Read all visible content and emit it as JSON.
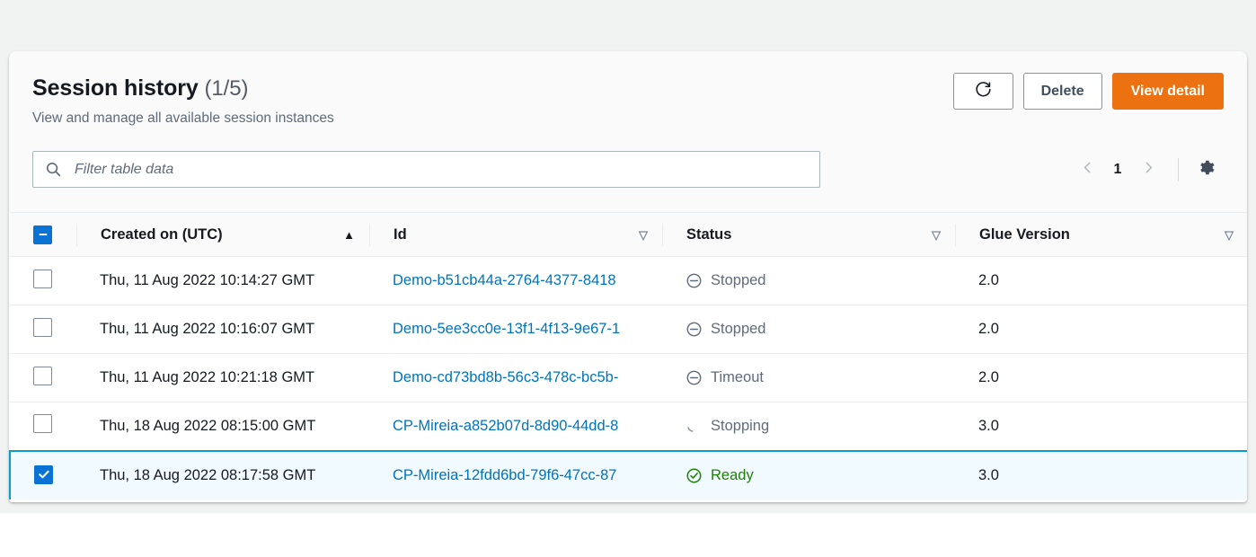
{
  "header": {
    "title": "Session history",
    "counter": "(1/5)",
    "subtitle": "View and manage all available session instances",
    "refresh_icon": "refresh-icon",
    "delete_label": "Delete",
    "view_detail_label": "View detail"
  },
  "toolbar": {
    "search_icon": "search-icon",
    "filter_placeholder": "Filter table data",
    "filter_value": "",
    "prev_icon": "chevron-left-icon",
    "next_icon": "chevron-right-icon",
    "page_number": "1",
    "settings_icon": "gear-icon"
  },
  "table": {
    "select_all_state": "indeterminate",
    "columns": [
      {
        "label": "Created on (UTC)",
        "sort": "asc",
        "sort_icon": "sort-ascending-icon"
      },
      {
        "label": "Id",
        "sort": "none",
        "sort_icon": "sort-icon"
      },
      {
        "label": "Status",
        "sort": "none",
        "sort_icon": "sort-icon"
      },
      {
        "label": "Glue Version",
        "sort": "none",
        "sort_icon": "sort-icon"
      }
    ],
    "rows": [
      {
        "selected": false,
        "created_on": "Thu, 11 Aug 2022 10:14:27 GMT",
        "id": "Demo-b51cb44a-2764-4377-8418",
        "status": "Stopped",
        "status_type": "neutral",
        "status_icon": "status-stopped-icon",
        "glue_version": "2.0"
      },
      {
        "selected": false,
        "created_on": "Thu, 11 Aug 2022 10:16:07 GMT",
        "id": "Demo-5ee3cc0e-13f1-4f13-9e67-1",
        "status": "Stopped",
        "status_type": "neutral",
        "status_icon": "status-stopped-icon",
        "glue_version": "2.0"
      },
      {
        "selected": false,
        "created_on": "Thu, 11 Aug 2022 10:21:18 GMT",
        "id": "Demo-cd73bd8b-56c3-478c-bc5b-",
        "status": "Timeout",
        "status_type": "neutral",
        "status_icon": "status-stopped-icon",
        "glue_version": "2.0"
      },
      {
        "selected": false,
        "created_on": "Thu, 18 Aug 2022 08:15:00 GMT",
        "id": "CP-Mireia-a852b07d-8d90-44dd-8",
        "status": "Stopping",
        "status_type": "loading",
        "status_icon": "spinner-icon",
        "glue_version": "3.0"
      },
      {
        "selected": true,
        "created_on": "Thu, 18 Aug 2022 08:17:58 GMT",
        "id": "CP-Mireia-12fdd6bd-79f6-47cc-87",
        "status": "Ready",
        "status_type": "success",
        "status_icon": "status-success-icon",
        "glue_version": "3.0"
      }
    ]
  },
  "colors": {
    "primary_button": "#ec7211",
    "link": "#0073bb",
    "checkbox": "#0972d3",
    "selected_border": "#0a9bc7",
    "selected_row_bg": "#f1faff",
    "success": "#1d8102",
    "neutral_text": "#5f6b7a"
  }
}
